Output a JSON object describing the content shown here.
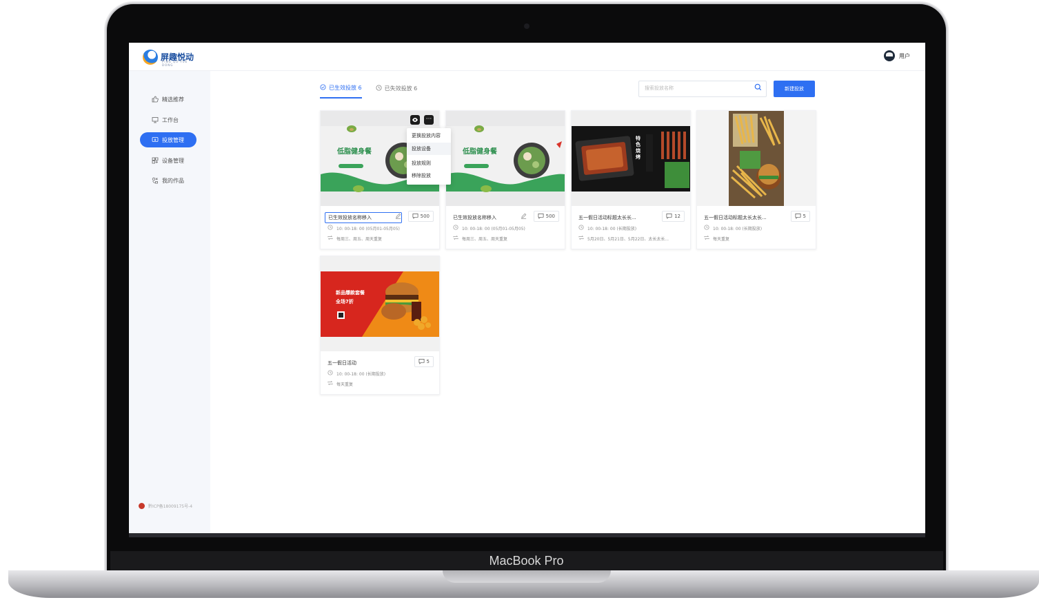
{
  "device": {
    "label": "MacBook Pro"
  },
  "app": {
    "logo_text": "屏趣悦动",
    "logo_sub": "PING QU YUE DONG",
    "user_label": "用户"
  },
  "sidebar": {
    "items": [
      {
        "label": "精选推荐",
        "icon": "thumbs-up-icon"
      },
      {
        "label": "工作台",
        "icon": "monitor-icon"
      },
      {
        "label": "投放管理",
        "icon": "cast-icon",
        "active": true
      },
      {
        "label": "设备管理",
        "icon": "device-icon"
      },
      {
        "label": "我的作品",
        "icon": "works-icon"
      }
    ],
    "icp": "黔ICP备18009175号-4"
  },
  "tabs": [
    {
      "label": "已生效投放 6",
      "active": true
    },
    {
      "label": "已失效投放 6",
      "active": false
    }
  ],
  "search": {
    "placeholder": "搜索投放名称"
  },
  "new_button": "新建投放",
  "cards": [
    {
      "title": "已生效投放名称移入",
      "comments": "500",
      "time": "10: 00-18: 00 (05月01-05月05)",
      "repeat": "每周三、周五、周天重复",
      "editing": true
    },
    {
      "title": "已生效投放名称移入",
      "comments": "500",
      "time": "10: 00-18: 00 (05月01-05月05)",
      "repeat": "每周三、周五、周天重复",
      "editing": false
    },
    {
      "title": "五一假日活动标题太长长...",
      "comments": "12",
      "time": "10: 00-18: 00 (长期投放)",
      "repeat": "5月20日、5月21日、5月22日、太长太长...",
      "editing": false
    },
    {
      "title": "五一假日活动标题太长太长...",
      "comments": "5",
      "time": "10: 00-18: 00 (长期投放)",
      "repeat": "每天重复",
      "editing": false
    },
    {
      "title": "五一假日活动",
      "comments": "5",
      "time": "10: 00-18: 00 (长期投放)",
      "repeat": "每天重复",
      "editing": false
    }
  ],
  "thumb_text": {
    "salad_title": "低脂健身餐",
    "bbq_title": "特色烧烤",
    "burger_title": "新品爆款套餐",
    "burger_sub": "全场7折"
  },
  "context_menu": [
    "更换投放内容",
    "投放设备",
    "投放规则",
    "移除投放"
  ],
  "colors": {
    "primary": "#2e6ff2",
    "sidebar_bg": "#f5f7fb"
  }
}
